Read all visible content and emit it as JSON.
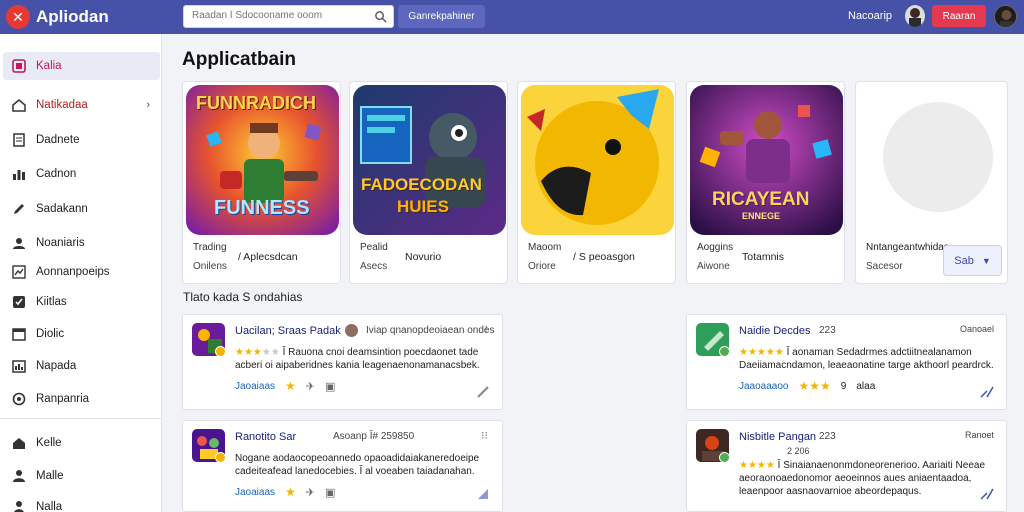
{
  "app": {
    "name": "Apliodan"
  },
  "header": {
    "search_placeholder": "Raadan Ǐ Sdocooname ooom",
    "search_button": "Ganrekpahiner",
    "username": "Nacoarip",
    "action_button": "Raaran"
  },
  "sidebar": {
    "items": [
      {
        "label": "Kalia",
        "icon": "home-icon"
      },
      {
        "label": "Natikadaa",
        "icon": "grid-icon"
      },
      {
        "label": "Dadnete",
        "icon": "document-icon"
      },
      {
        "label": "Cadnon",
        "icon": "chart-icon"
      },
      {
        "label": "Sadakann",
        "icon": "pen-icon"
      },
      {
        "label": "Noaniaris",
        "icon": "user-icon"
      },
      {
        "label": "Aonnanpoeips",
        "icon": "trend-icon"
      },
      {
        "label": "Kiitlas",
        "icon": "check-icon"
      },
      {
        "label": "Diolic",
        "icon": "calendar-icon"
      },
      {
        "label": "Napada",
        "icon": "bars-icon"
      },
      {
        "label": "Ranpanria",
        "icon": "settings-icon"
      },
      {
        "label": "Kelle",
        "icon": "person-icon"
      },
      {
        "label": "Malle",
        "icon": "people-icon"
      },
      {
        "label": "Nalla",
        "icon": "profile-icon"
      }
    ]
  },
  "main": {
    "section_title": "Applicatbain",
    "cards": [
      {
        "art_title": "FUNNRADICH",
        "art_subtitle": "FUNNESS",
        "top": "Trading",
        "bottom": "Onilens",
        "middle": "/ Aplecsdcan"
      },
      {
        "art_title": "FADOECODAN",
        "art_subtitle": "HUIES",
        "top": "Pealid",
        "bottom": "Asecs",
        "middle": "Novurio"
      },
      {
        "art_title": "",
        "art_subtitle": "",
        "top": "Maoom",
        "bottom": "Oriore",
        "middle": "/ S peoasgon"
      },
      {
        "art_title": "RICAYEAN",
        "art_subtitle": "ENNEGE",
        "top": "Aoggins",
        "bottom": "Aiwone",
        "middle": "Totamnis"
      },
      {
        "art_title": "",
        "art_subtitle": "",
        "top": "Nntangeantwhidas",
        "bottom": "Sacesor",
        "middle": "",
        "button": "Sab"
      }
    ],
    "sub_title": "Tlato kada S ondahias",
    "reviews": [
      {
        "name": "Uacilan; Sraas Padak",
        "meta": "Iviap qnanopdeoiaean ondes",
        "stars": 3,
        "text": "Ǐ Rauona cnoi deamsintion poecdaonet tade acberi oi aipaberidnes kania leagenaenonamanacsbek.",
        "footer_label": "Jaoaiaas",
        "footer_a": "",
        "footer_b": ""
      },
      {
        "name": "Naidie Decdes",
        "count": "223",
        "tag": "Oanoael",
        "stars": 5,
        "text": "Ǐ aonaman Sedadrmes adctiitnealanamon Daeiiamacndamon, leaeaonatine targe akthoorl peardrck.",
        "footer_label": "Jaaoaaaoo",
        "footer_a": "9",
        "footer_b": "alaa"
      },
      {
        "name": "Ranotito Sar",
        "meta": "Asoanp Ǐ# 259850",
        "stars": 0,
        "text": "Nogane aodaocopeoannedo opaoadidaiakaneredoeipe cadeiteafead lanedocebies. Ǐ al voeaben taiadanahan.",
        "footer_label": "Jaoaiaas",
        "footer_a": "",
        "footer_b": ""
      },
      {
        "name": "Nisbitle Pangan",
        "count": "223",
        "tag": "Ranoet",
        "stars": 4,
        "sub": "2 206",
        "text": "Ǐ Sinaianaenonmdoneorenerioo. Aariaiti Neeae aeoraonoaedonomor aeoeinnos aues aniaentaadoa, leaenpoor aasnaovarnioe abeordepaqus.",
        "footer_label": "",
        "footer_a": "",
        "footer_b": ""
      }
    ]
  },
  "colors": {
    "topbar": "#4651a8",
    "accent_red": "#e53950",
    "link_blue": "#1a237e",
    "star": "#f4b400"
  }
}
